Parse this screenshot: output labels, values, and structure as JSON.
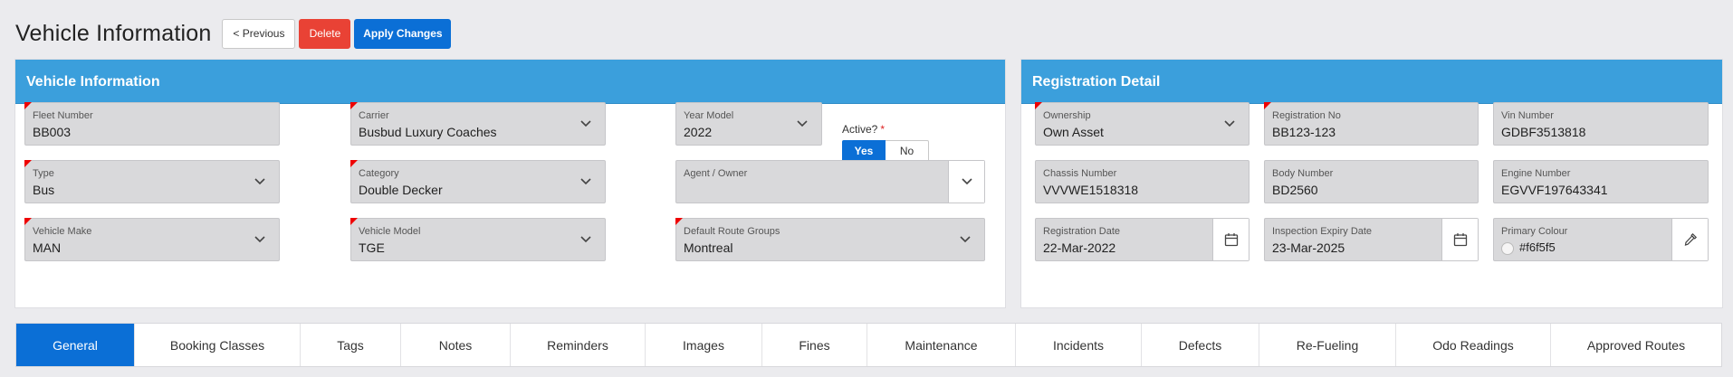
{
  "header": {
    "title": "Vehicle Information",
    "prev_label": "< Previous",
    "delete_label": "Delete",
    "apply_label": "Apply Changes"
  },
  "vehicle_region": {
    "title": "Vehicle Information",
    "fleet_number": {
      "label": "Fleet Number",
      "value": "BB003"
    },
    "carrier": {
      "label": "Carrier",
      "value": "Busbud Luxury Coaches"
    },
    "year_model": {
      "label": "Year Model",
      "value": "2022"
    },
    "active": {
      "label": "Active?",
      "required_mark": "*",
      "yes": "Yes",
      "no": "No",
      "selected": "Yes"
    },
    "type": {
      "label": "Type",
      "value": "Bus"
    },
    "category": {
      "label": "Category",
      "value": "Double Decker"
    },
    "agent_owner": {
      "label": "Agent / Owner",
      "value": ""
    },
    "vehicle_make": {
      "label": "Vehicle Make",
      "value": "MAN"
    },
    "vehicle_model": {
      "label": "Vehicle Model",
      "value": "TGE"
    },
    "default_route_groups": {
      "label": "Default Route Groups",
      "value": "Montreal"
    }
  },
  "registration_region": {
    "title": "Registration Detail",
    "ownership": {
      "label": "Ownership",
      "value": "Own Asset"
    },
    "registration_no": {
      "label": "Registration No",
      "value": "BB123-123"
    },
    "vin_number": {
      "label": "Vin Number",
      "value": "GDBF3513818"
    },
    "chassis_number": {
      "label": "Chassis Number",
      "value": "VVVWE1518318"
    },
    "body_number": {
      "label": "Body Number",
      "value": "BD2560"
    },
    "engine_number": {
      "label": "Engine Number",
      "value": "EGVVF197643341"
    },
    "registration_date": {
      "label": "Registration Date",
      "value": "22-Mar-2022"
    },
    "inspection_expiry_date": {
      "label": "Inspection Expiry Date",
      "value": "23-Mar-2025"
    },
    "primary_colour": {
      "label": "Primary Colour",
      "value": "#f6f5f5"
    }
  },
  "tabs": [
    {
      "label": "General",
      "active": true
    },
    {
      "label": "Booking Classes"
    },
    {
      "label": "Tags"
    },
    {
      "label": "Notes"
    },
    {
      "label": "Reminders"
    },
    {
      "label": "Images"
    },
    {
      "label": "Fines"
    },
    {
      "label": "Maintenance"
    },
    {
      "label": "Incidents"
    },
    {
      "label": "Defects"
    },
    {
      "label": "Re-Fueling"
    },
    {
      "label": "Odo Readings"
    },
    {
      "label": "Approved Routes"
    }
  ],
  "colors": {
    "region_header": "#3b9fdc",
    "primary": "#0b6fd6",
    "danger": "#e94235",
    "field_bg": "#d9d9db",
    "required_marker": "#e00000"
  }
}
